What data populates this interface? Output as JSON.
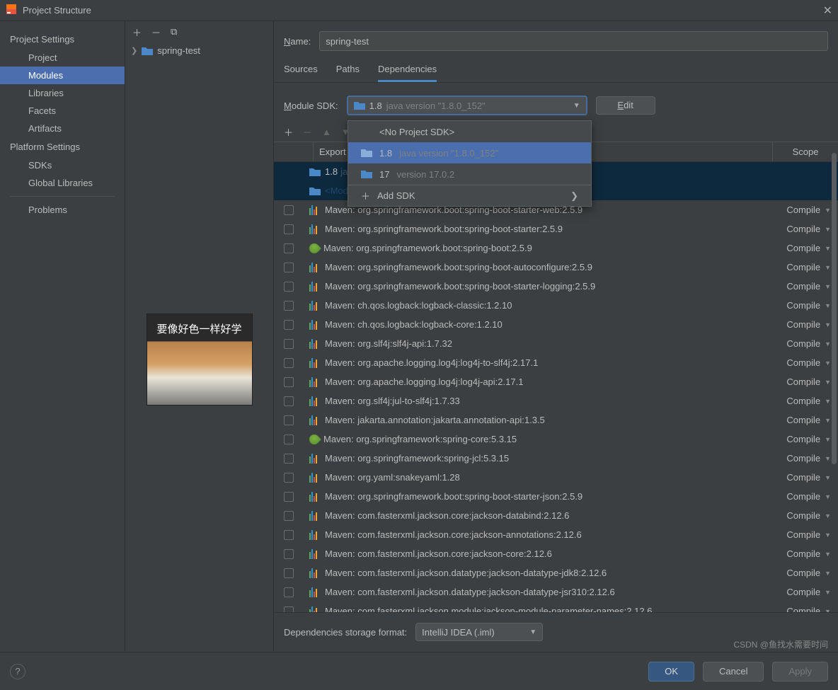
{
  "window": {
    "title": "Project Structure"
  },
  "leftnav": {
    "project_settings": "Project Settings",
    "items1": [
      "Project",
      "Modules",
      "Libraries",
      "Facets",
      "Artifacts"
    ],
    "platform_settings": "Platform Settings",
    "items2": [
      "SDKs",
      "Global Libraries"
    ],
    "problems": "Problems"
  },
  "tree": {
    "module": "spring-test",
    "img_text": "要像好色一样好学"
  },
  "name": {
    "label_pre": "N",
    "label_post": "ame:",
    "value": "spring-test"
  },
  "tabs": {
    "sources": "Sources",
    "paths": "Paths",
    "deps": "Dependencies"
  },
  "sdk": {
    "label_pre": "M",
    "label_post": "odule SDK:",
    "selected_main": "1.8",
    "selected_detail": "java version \"1.8.0_152\"",
    "edit_pre": "E",
    "edit_post": "dit"
  },
  "dropdown": {
    "no_sdk": "<No Project SDK>",
    "opt1_main": "1.8",
    "opt1_detail": "java version \"1.8.0_152\"",
    "opt2_main": "17",
    "opt2_detail": "version 17.0.2",
    "add": "Add SDK"
  },
  "table": {
    "export": "Export",
    "scope": "Scope",
    "row1_main": "1.8",
    "row1_detail": "java version \"1.8.0_152\"",
    "row2": "<Module source>",
    "scope_val": "Compile",
    "deps": [
      {
        "icon": "lib",
        "text": "Maven: org.springframework.boot:spring-boot-starter-web:2.5.9"
      },
      {
        "icon": "lib",
        "text": "Maven: org.springframework.boot:spring-boot-starter:2.5.9"
      },
      {
        "icon": "leaf",
        "text": "Maven: org.springframework.boot:spring-boot:2.5.9"
      },
      {
        "icon": "lib",
        "text": "Maven: org.springframework.boot:spring-boot-autoconfigure:2.5.9"
      },
      {
        "icon": "lib",
        "text": "Maven: org.springframework.boot:spring-boot-starter-logging:2.5.9"
      },
      {
        "icon": "lib",
        "text": "Maven: ch.qos.logback:logback-classic:1.2.10"
      },
      {
        "icon": "lib",
        "text": "Maven: ch.qos.logback:logback-core:1.2.10"
      },
      {
        "icon": "lib",
        "text": "Maven: org.slf4j:slf4j-api:1.7.32"
      },
      {
        "icon": "lib",
        "text": "Maven: org.apache.logging.log4j:log4j-to-slf4j:2.17.1"
      },
      {
        "icon": "lib",
        "text": "Maven: org.apache.logging.log4j:log4j-api:2.17.1"
      },
      {
        "icon": "lib",
        "text": "Maven: org.slf4j:jul-to-slf4j:1.7.33"
      },
      {
        "icon": "lib",
        "text": "Maven: jakarta.annotation:jakarta.annotation-api:1.3.5"
      },
      {
        "icon": "leaf",
        "text": "Maven: org.springframework:spring-core:5.3.15"
      },
      {
        "icon": "lib",
        "text": "Maven: org.springframework:spring-jcl:5.3.15"
      },
      {
        "icon": "lib",
        "text": "Maven: org.yaml:snakeyaml:1.28"
      },
      {
        "icon": "lib",
        "text": "Maven: org.springframework.boot:spring-boot-starter-json:2.5.9"
      },
      {
        "icon": "lib",
        "text": "Maven: com.fasterxml.jackson.core:jackson-databind:2.12.6"
      },
      {
        "icon": "lib",
        "text": "Maven: com.fasterxml.jackson.core:jackson-annotations:2.12.6"
      },
      {
        "icon": "lib",
        "text": "Maven: com.fasterxml.jackson.core:jackson-core:2.12.6"
      },
      {
        "icon": "lib",
        "text": "Maven: com.fasterxml.jackson.datatype:jackson-datatype-jdk8:2.12.6"
      },
      {
        "icon": "lib",
        "text": "Maven: com.fasterxml.jackson.datatype:jackson-datatype-jsr310:2.12.6"
      },
      {
        "icon": "lib",
        "text": "Maven: com.fasterxml.jackson.module:jackson-module-parameter-names:2.12.6"
      }
    ]
  },
  "storage": {
    "label": "Dependencies storage format:",
    "value": "IntelliJ IDEA (.iml)"
  },
  "footer": {
    "ok": "OK",
    "cancel": "Cancel",
    "apply": "Apply"
  },
  "watermark": "CSDN @鱼找水需要时间"
}
